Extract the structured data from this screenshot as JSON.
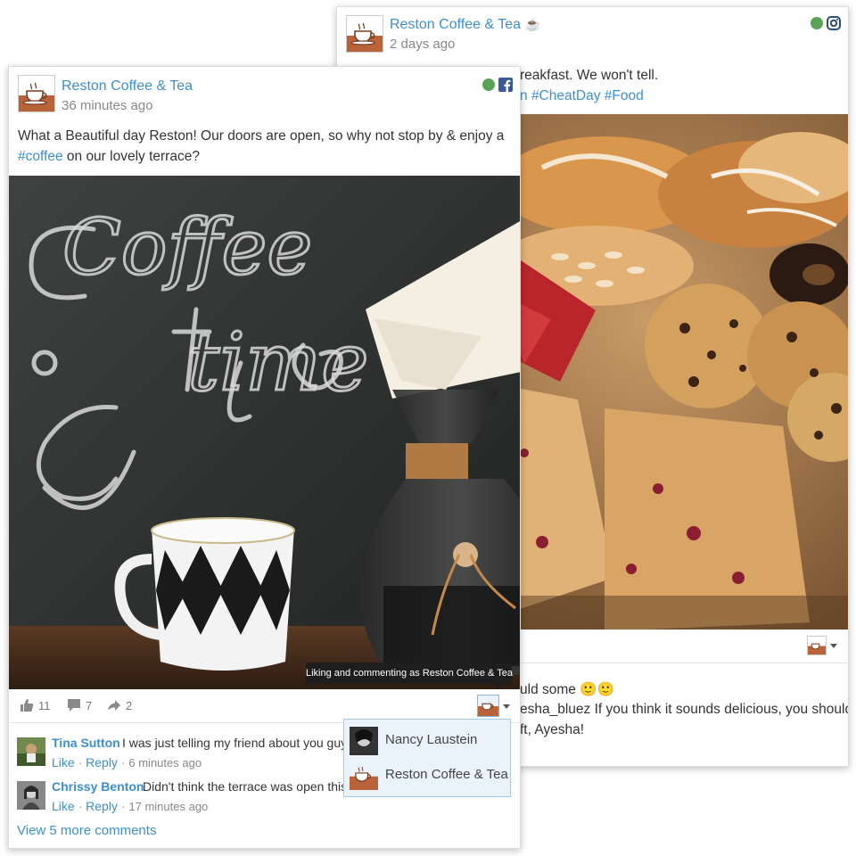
{
  "back_post": {
    "page_name": "Reston Coffee & Tea",
    "name_emoji": "☕",
    "timestamp": "2 days ago",
    "network_icon": "instagram-icon",
    "text_line1": "reakfast.  We won't tell.",
    "text_line2_prefix": "n",
    "hashtags": [
      "#CheatDay",
      "#Food"
    ],
    "comment_line1": "uld some 🙂🙂",
    "comment_line2": "esha_bluez If you think it sounds delicious, you should",
    "comment_line3": "ft, Ayesha!"
  },
  "front_post": {
    "page_name": "Reston Coffee & Tea",
    "timestamp": "36 minutes ago",
    "network_icon": "facebook-icon",
    "text_line1": "What a Beautiful day Reston! Our doors are open, so why not stop by & enjoy a",
    "text_hashtag": "#coffee",
    "text_line2_rest": "on our lovely terrace?",
    "photo_text_1": "Coffee",
    "photo_text_2": "time",
    "actions": {
      "likes": "11",
      "comments": "7",
      "shares": "2"
    },
    "comments": [
      {
        "author": "Tina Sutton",
        "text": "I was just telling my friend about you guy",
        "like": "Like",
        "reply": "Reply",
        "ago": "6 minutes ago"
      },
      {
        "author": "Chrissy Benton",
        "text": "Didn't think the terrace was open this",
        "like": "Like",
        "reply": "Reply",
        "ago": "17 minutes ago"
      }
    ],
    "view_more": "View 5 more comments",
    "tooltip": "Liking and commenting as Reston Coffee & Tea",
    "identity_options": [
      "Nancy Laustein",
      "Reston Coffee & Tea"
    ]
  },
  "colors": {
    "link_blue": "#3b8fd4",
    "status_green": "#5aa356",
    "facebook_blue": "#3b5998",
    "logo_brown": "#b9633a"
  }
}
